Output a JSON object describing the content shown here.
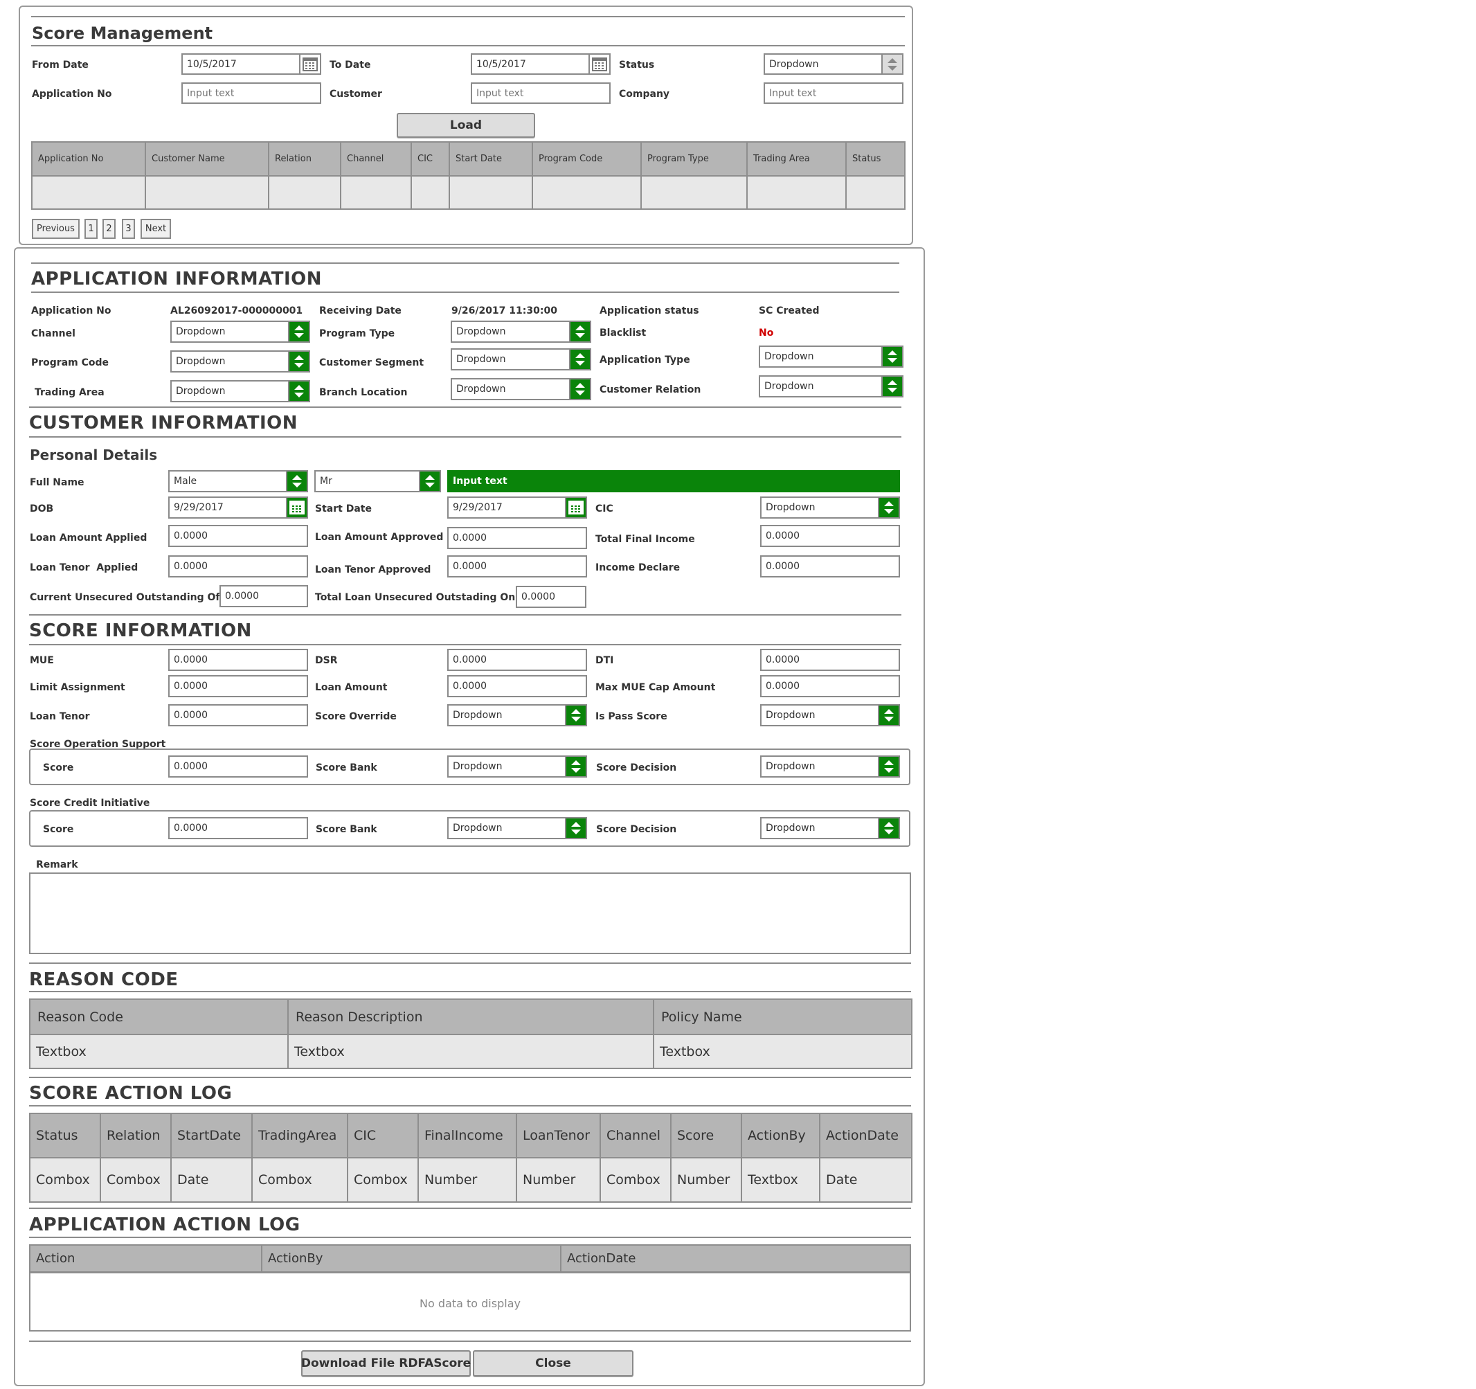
{
  "score_management": {
    "title": "Score Management",
    "from_date_label": "From Date",
    "from_date_value": "10/5/2017",
    "to_date_label": "To Date",
    "to_date_value": "10/5/2017",
    "status_label": "Status",
    "status_value": "Dropdown",
    "application_no_label": "Application No",
    "application_no_placeholder": "Input text",
    "customer_label": "Customer",
    "customer_placeholder": "Input text",
    "company_label": "Company",
    "company_placeholder": "Input text",
    "load_button": "Load",
    "table": {
      "headers": [
        "Application No",
        "Customer Name",
        "Relation",
        "Channel",
        "CIC",
        "Start Date",
        "Program Code",
        "Program Type",
        "Trading Area",
        "Status"
      ]
    },
    "pagination": {
      "previous": "Previous",
      "pages": [
        "1",
        "2",
        "3"
      ],
      "next": "Next"
    }
  },
  "application_information": {
    "title": "APPLICATION INFORMATION",
    "application_no_label": "Application No",
    "application_no_value": "AL26092017-000000001",
    "receiving_date_label": "Receiving Date",
    "receiving_date_value": "9/26/2017 11:30:00",
    "application_status_label": "Application status",
    "application_status_value": "SC Created",
    "channel_label": "Channel",
    "channel_value": "Dropdown",
    "program_type_label": "Program Type",
    "program_type_value": "Dropdown",
    "blacklist_label": "Blacklist",
    "blacklist_value": "No",
    "program_code_label": "Program Code",
    "program_code_value": "Dropdown",
    "customer_segment_label": "Customer Segment",
    "customer_segment_value": "Dropdown",
    "application_type_label": "Application Type",
    "application_type_value": "Dropdown",
    "trading_area_label": "Trading Area",
    "trading_area_value": "Dropdown",
    "branch_location_label": "Branch Location",
    "branch_location_value": "Dropdown",
    "customer_relation_label": "Customer Relation",
    "customer_relation_value": "Dropdown"
  },
  "customer_information": {
    "title": "CUSTOMER INFORMATION",
    "personal_details": "Personal Details",
    "full_name_label": "Full Name",
    "gender_value": "Male",
    "title_value": "Mr",
    "full_name_value": "Input text",
    "dob_label": "DOB",
    "dob_value": "9/29/2017",
    "start_date_label": "Start Date",
    "start_date_value": "9/29/2017",
    "cic_label": "CIC",
    "cic_value": "Dropdown",
    "loan_amount_applied_label": "Loan Amount Applied",
    "loan_amount_applied_value": "0.0000",
    "loan_amount_approved_label": "Loan Amount Approved",
    "loan_amount_approved_value": "0.0000",
    "total_final_income_label": "Total Final Income",
    "total_final_income_value": "0.0000",
    "loan_tenor_applied_label": "Loan Tenor  Applied",
    "loan_tenor_applied_value": "0.0000",
    "loan_tenor_approved_label": "Loan Tenor Approved",
    "loan_tenor_approved_value": "0.0000",
    "income_declare_label": "Income Declare",
    "income_declare_value": "0.0000",
    "current_unsecured_label": "Current Unsecured Outstanding Off Us",
    "current_unsecured_value": "0.0000",
    "total_loan_unsecured_label": "Total Loan Unsecured Outstading On Us",
    "total_loan_unsecured_value": "0.0000"
  },
  "score_information": {
    "title": "SCORE INFORMATION",
    "mue_label": "MUE",
    "mue_value": "0.0000",
    "dsr_label": "DSR",
    "dsr_value": "0.0000",
    "dti_label": "DTI",
    "dti_value": "0.0000",
    "limit_assignment_label": "Limit Assignment",
    "limit_assignment_value": "0.0000",
    "loan_amount_label": "Loan Amount",
    "loan_amount_value": "0.0000",
    "max_mue_label": "Max MUE Cap Amount",
    "max_mue_value": "0.0000",
    "loan_tenor_label": "Loan Tenor",
    "loan_tenor_value": "0.0000",
    "score_override_label": "Score Override",
    "score_override_value": "Dropdown",
    "is_pass_score_label": "Is Pass Score",
    "is_pass_score_value": "Dropdown",
    "ops_support_title": "Score Operation Support",
    "ops_score_label": "Score",
    "ops_score_value": "0.0000",
    "ops_score_bank_label": "Score Bank",
    "ops_score_bank_value": "Dropdown",
    "ops_score_decision_label": "Score Decision",
    "ops_score_decision_value": "Dropdown",
    "credit_initiative_title": "Score Credit Initiative",
    "ci_score_label": "Score",
    "ci_score_value": "0.0000",
    "ci_score_bank_label": "Score Bank",
    "ci_score_bank_value": "Dropdown",
    "ci_score_decision_label": "Score Decision",
    "ci_score_decision_value": "Dropdown",
    "remark_label": "Remark"
  },
  "reason_code": {
    "title": "REASON CODE",
    "headers": [
      "Reason Code",
      "Reason Description",
      "Policy Name"
    ],
    "row": [
      "Textbox",
      "Textbox",
      "Textbox"
    ]
  },
  "score_action_log": {
    "title": "SCORE ACTION LOG",
    "headers": [
      "Status",
      "Relation",
      "StartDate",
      "TradingArea",
      "CIC",
      "FinalIncome",
      "LoanTenor",
      "Channel",
      "Score",
      "ActionBy",
      "ActionDate"
    ],
    "row": [
      "Combox",
      "Combox",
      "Date",
      "Combox",
      "Combox",
      "Number",
      "Number",
      "Combox",
      "Number",
      "Textbox",
      "Date"
    ]
  },
  "application_action_log": {
    "title": "APPLICATION ACTION LOG",
    "headers": [
      "Action",
      "ActionBy",
      "ActionDate"
    ],
    "empty_text": "No data to display"
  },
  "footer": {
    "download_button": "Download File RDFAScore",
    "close_button": "Close"
  },
  "colors": {
    "accent_green": "#0a840a",
    "header_gray": "#b5b5b5",
    "cell_gray": "#e8e8e8",
    "alert_red": "#d00000"
  }
}
